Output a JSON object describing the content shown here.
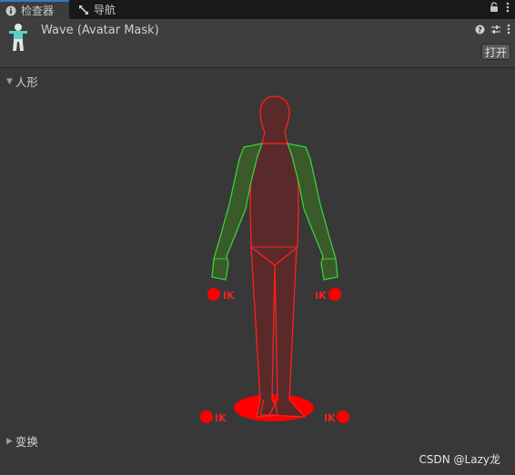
{
  "tabs": [
    {
      "label": "检查器",
      "icon": "info-icon",
      "active": true
    },
    {
      "label": "导航",
      "icon": "navigation-icon",
      "active": false
    }
  ],
  "tabbar_icons": [
    "lock-icon",
    "kebab-menu-icon"
  ],
  "header": {
    "title": "Wave (Avatar Mask)",
    "icon": "avatar-mask-icon",
    "icons": [
      "help-icon",
      "settings-sliders-icon",
      "kebab-menu-icon"
    ],
    "open_button": "打开"
  },
  "sections": {
    "humanoid": {
      "label": "人形",
      "expanded": true
    },
    "transform": {
      "label": "变换",
      "expanded": false
    }
  },
  "ik": {
    "label": "IK"
  },
  "watermark": "CSDN @Lazy龙",
  "colors": {
    "enabled": "#39d039",
    "disabled": "#ff1f1f",
    "ik_dot": "#ff0000",
    "background": "#383838"
  }
}
